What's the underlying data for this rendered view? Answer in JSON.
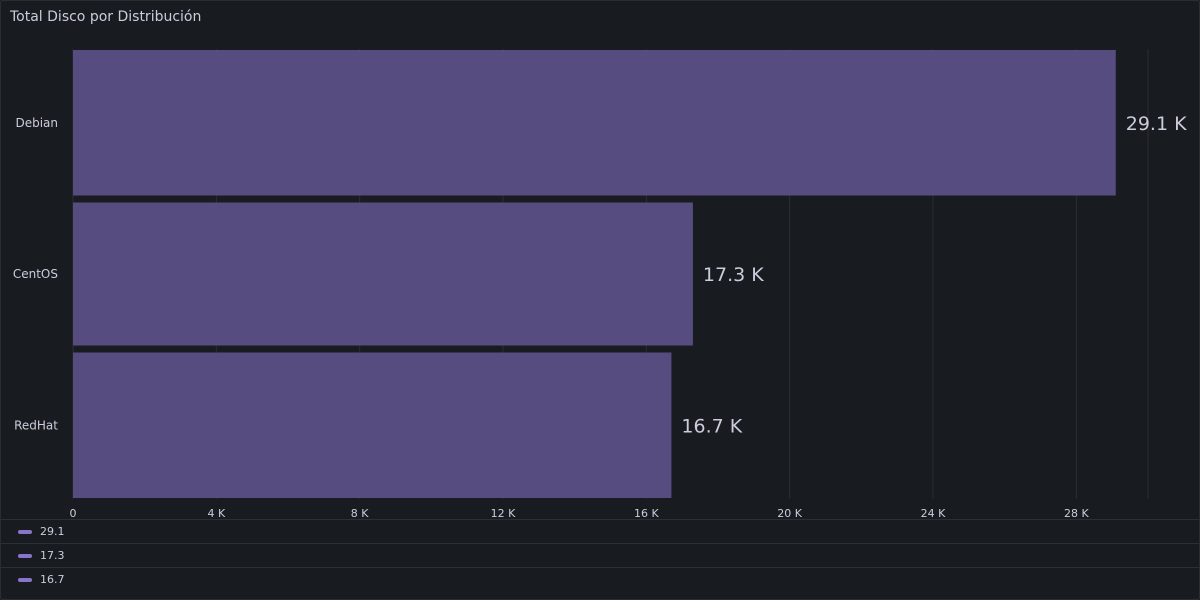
{
  "panel": {
    "title": "Total Disco por Distribución"
  },
  "chart_data": {
    "type": "bar",
    "orientation": "horizontal",
    "categories": [
      "Debian",
      "CentOS",
      "RedHat"
    ],
    "values": [
      29100,
      17300,
      16700
    ],
    "value_labels": [
      "29.1 K",
      "17.3 K",
      "16.7 K"
    ],
    "xlim": [
      0,
      30000
    ],
    "x_ticks": [
      0,
      4000,
      8000,
      12000,
      16000,
      20000,
      24000,
      28000
    ],
    "x_tick_labels": [
      "0",
      "4 K",
      "8 K",
      "12 K",
      "16 K",
      "20 K",
      "24 K",
      "28 K"
    ],
    "bar_color": "#574c80",
    "grid": true,
    "legend": {
      "placement": "bottom",
      "entries": [
        "29.1",
        "17.3",
        "16.7"
      ],
      "color": "#8a74c8"
    }
  }
}
